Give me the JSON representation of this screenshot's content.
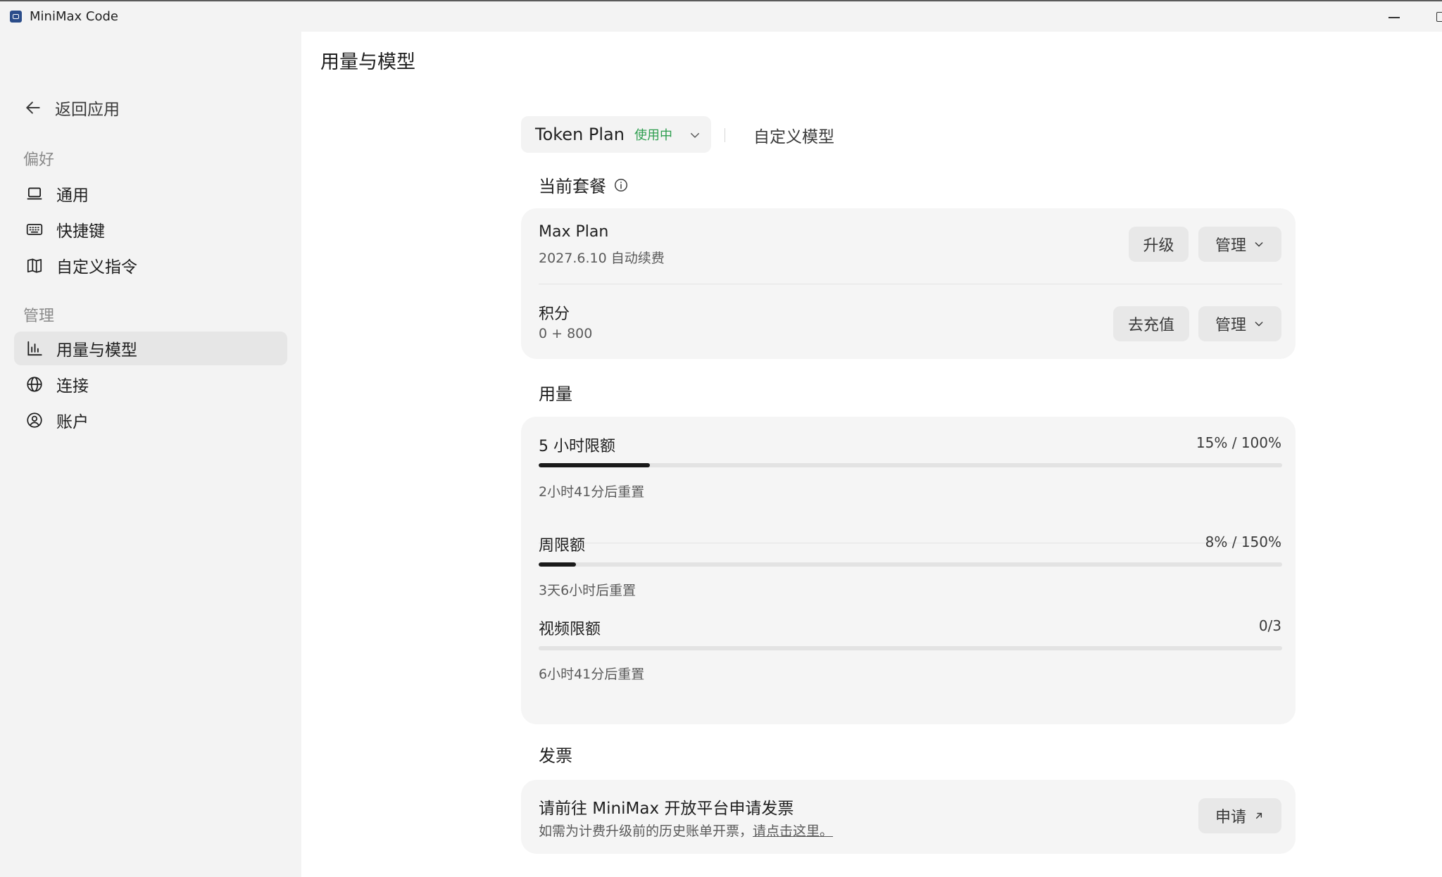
{
  "window": {
    "title": "MiniMax Code"
  },
  "sidebar": {
    "back_label": "返回应用",
    "section_preferences": "偏好",
    "preferences": [
      {
        "label": "通用",
        "icon": "laptop-icon"
      },
      {
        "label": "快捷键",
        "icon": "keyboard-icon"
      },
      {
        "label": "自定义指令",
        "icon": "book-icon"
      }
    ],
    "section_manage": "管理",
    "manage": [
      {
        "label": "用量与模型",
        "icon": "bar-chart-icon",
        "active": true
      },
      {
        "label": "连接",
        "icon": "globe-icon"
      },
      {
        "label": "账户",
        "icon": "user-circle-icon"
      }
    ]
  },
  "main": {
    "page_title": "用量与模型",
    "plan_selector": {
      "name": "Token Plan",
      "status": "使用中"
    },
    "custom_model_tab": "自定义模型",
    "current_plan_heading": "当前套餐",
    "plan": {
      "name": "Max Plan",
      "renewal": "2027.6.10 自动续费",
      "upgrade_label": "升级",
      "manage_label": "管理"
    },
    "credits": {
      "label": "积分",
      "value": "0 + 800",
      "recharge_label": "去充值",
      "manage_label": "管理"
    },
    "usage_heading": "用量",
    "usage": [
      {
        "label": "5 小时限额",
        "value": "15% / 100%",
        "fraction": 0.15,
        "reset": "2小时41分后重置"
      },
      {
        "label": "周限额",
        "value": "8% / 150%",
        "fraction": 0.05,
        "reset": "3天6小时后重置"
      },
      {
        "label": "视频限额",
        "value": "0/3",
        "fraction": 0.0,
        "reset": "6小时41分后重置"
      }
    ],
    "invoice_heading": "发票",
    "invoice": {
      "title": "请前往 MiniMax 开放平台申请发票",
      "desc_prefix": "如需为计费升级前的历史账单开票，",
      "desc_link": "请点击这里。",
      "apply_label": "申请"
    }
  },
  "colors": {
    "sidebar_bg": "#f3f3f3",
    "card_bg": "#f5f5f5",
    "active_item_bg": "#e6e6e6",
    "status_green": "#2e9e4f",
    "progress_fill": "#1a1a1a",
    "progress_track": "#e3e3e3"
  }
}
